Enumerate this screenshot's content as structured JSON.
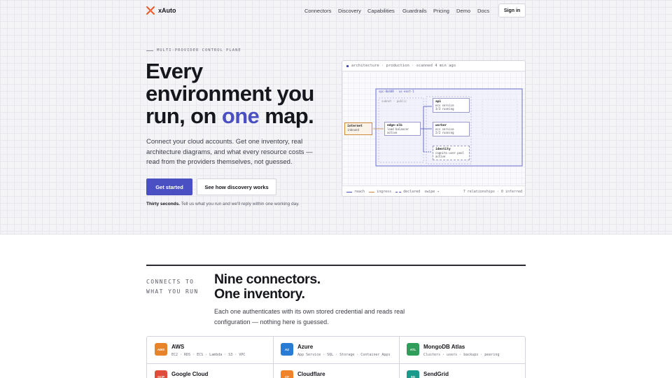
{
  "brand": {
    "name": "xAuto",
    "accent": "#4a4fc2",
    "logo_color": "#e8592a"
  },
  "nav": {
    "links": [
      "Connectors",
      "Discovery",
      "Capabilities",
      "Guardrails",
      "Pricing",
      "Demo",
      "Docs"
    ],
    "signin": "Sign in"
  },
  "hero": {
    "eyebrow": "MULTI-PROVIDER CONTROL PLANE",
    "headline_1": "Every",
    "headline_2": "environment you",
    "headline_3a": "run, on ",
    "headline_3b": "one",
    "headline_3c": " map.",
    "sub": "Connect your cloud accounts. Get one inventory, real architecture diagrams, and what every resource costs — read from the providers themselves, not guessed.",
    "cta_primary": "Get started",
    "cta_secondary": "See how discovery works",
    "note_bold": "Thirty seconds.",
    "note_rest": " Tell us what you run and we'll reply within one working day."
  },
  "architecture": {
    "header": "architecture · production · scanned 4 min ago",
    "vpc_label": "vpc-0a4d8 · us-east-1",
    "subnet_label": "subnet · public",
    "nodes": {
      "internet": {
        "title": "internet",
        "sub": "inbound"
      },
      "edge": {
        "title": "edge-alb",
        "sub1": "load balancer",
        "sub2": "active"
      },
      "api": {
        "title": "api",
        "sub1": "ecs service",
        "sub2": "3/3 running"
      },
      "worker": {
        "title": "worker",
        "sub1": "ecs service",
        "sub2": "2/2 running"
      },
      "identity": {
        "title": "identity",
        "sub1": "cognito user pool",
        "sub2": "active"
      }
    },
    "legend": {
      "reach": "reach",
      "ingress": "ingress",
      "declared": "declared",
      "swipe": "swipe →"
    },
    "stats": "7 relationships · 0 inferred"
  },
  "connectors": {
    "eyebrow_1": "CONNECTS TO",
    "eyebrow_2": "WHAT YOU RUN",
    "title_1": "Nine connectors.",
    "title_2": "One inventory.",
    "sub": "Each one authenticates with its own stored credential and reads real configuration — nothing here is guessed.",
    "items": [
      {
        "badge": "AWS",
        "name": "AWS",
        "services": "EC2 · RDS · ECS · Lambda · S3 · VPC",
        "color": "#e8832a"
      },
      {
        "badge": "AZ",
        "name": "Azure",
        "services": "App Service · SQL · Storage · Container Apps",
        "color": "#2a7bd4"
      },
      {
        "badge": "ATL",
        "name": "MongoDB Atlas",
        "services": "Clusters · users · backups · peering",
        "color": "#2f9e5a"
      },
      {
        "badge": "GCP",
        "name": "Google Cloud",
        "services": "",
        "color": "#e24a3a"
      },
      {
        "badge": "CF",
        "name": "Cloudflare",
        "services": "",
        "color": "#f0822a"
      },
      {
        "badge": "SG",
        "name": "SendGrid",
        "services": "",
        "color": "#1a9a8a"
      }
    ]
  }
}
